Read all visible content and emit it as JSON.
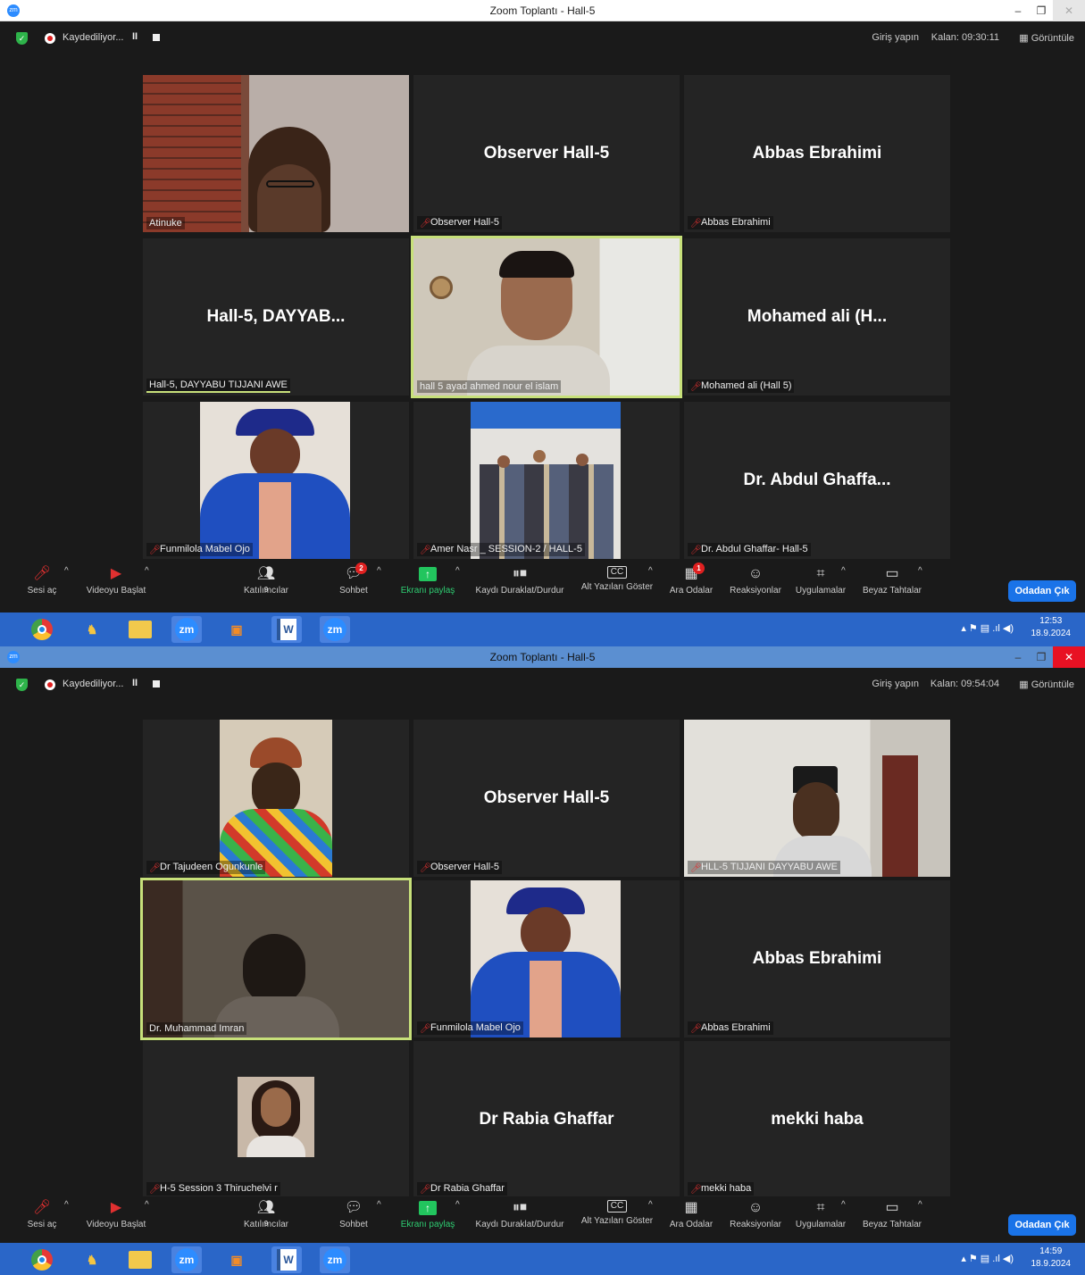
{
  "windows": [
    {
      "title": "Zoom Toplantı - Hall-5",
      "recording_text": "Kaydediliyor...",
      "signin": "Giriş yapın",
      "remaining": "Kalan: 09:30:11",
      "view": "Görüntüle",
      "tiles": [
        {
          "big": "",
          "label": "Atinuke",
          "muted": false,
          "photo": "person-glasses"
        },
        {
          "big": "Observer Hall-5",
          "label": "Observer Hall-5",
          "muted": true
        },
        {
          "big": "Abbas Ebrahimi",
          "label": "Abbas Ebrahimi",
          "muted": true
        },
        {
          "big": "Hall-5, DAYYAB...",
          "label": "Hall-5, DAYYABU TIJJANI AWE",
          "muted": false
        },
        {
          "big": "",
          "label": "hall 5  ayad ahmed nour el islam",
          "muted": false,
          "photo": "man-room"
        },
        {
          "big": "Mohamed ali (H...",
          "label": "Mohamed ali (Hall 5)",
          "muted": true
        },
        {
          "big": "",
          "label": "Funmilola Mabel Ojo",
          "muted": true,
          "photo": "graduation"
        },
        {
          "big": "",
          "label": "Amer Nasr _ SESSION-2 / HALL-5",
          "muted": true,
          "photo": "group"
        },
        {
          "big": "Dr. Abdul Ghaffa...",
          "label": "Dr. Abdul Ghaffar- Hall-5",
          "muted": true
        }
      ],
      "toolbar": {
        "unmute": "Sesi aç",
        "video": "Videoyu Başlat",
        "participants": "Katılımcılar",
        "participants_count": "9",
        "chat": "Sohbet",
        "chat_badge": "2",
        "share": "Ekranı paylaş",
        "record": "Kaydı Duraklat/Durdur",
        "captions": "Alt Yazıları Göster",
        "breakout": "Ara Odalar",
        "breakout_badge": "1",
        "reactions": "Reaksiyonlar",
        "apps": "Uygulamalar",
        "whiteboard": "Beyaz Tahtalar",
        "leave": "Odadan Çık"
      },
      "clock_time": "12:53",
      "clock_date": "18.9.2024"
    },
    {
      "title": "Zoom Toplantı - Hall-5",
      "recording_text": "Kaydediliyor...",
      "signin": "Giriş yapın",
      "remaining": "Kalan: 09:54:04",
      "view": "Görüntüle",
      "tiles": [
        {
          "big": "",
          "label": "Dr Tajudeen Ogunkunle",
          "muted": true,
          "photo": "man-cap"
        },
        {
          "big": "Observer Hall-5",
          "label": "Observer Hall-5",
          "muted": true
        },
        {
          "big": "",
          "label": "HLL-5 TIJJANI DAYYABU AWE",
          "muted": true,
          "photo": "man-white-room"
        },
        {
          "big": "",
          "label": "Dr. Muhammad Imran",
          "muted": false,
          "photo": "dark-cam"
        },
        {
          "big": "",
          "label": "Funmilola Mabel Ojo",
          "muted": true,
          "photo": "graduation"
        },
        {
          "big": "Abbas Ebrahimi",
          "label": "Abbas Ebrahimi",
          "muted": true
        },
        {
          "big": "",
          "label": "H-5 Session 3 Thiruchelvi r",
          "muted": true,
          "photo": "woman-portrait"
        },
        {
          "big": "Dr Rabia Ghaffar",
          "label": "Dr Rabia Ghaffar",
          "muted": true
        },
        {
          "big": "mekki haba",
          "label": "mekki haba",
          "muted": true
        }
      ],
      "toolbar": {
        "unmute": "Sesi aç",
        "video": "Videoyu Başlat",
        "participants": "Katılımcılar",
        "participants_count": "9",
        "chat": "Sohbet",
        "chat_badge": "",
        "share": "Ekranı paylaş",
        "record": "Kaydı Duraklat/Durdur",
        "captions": "Alt Yazıları Göster",
        "breakout": "Ara Odalar",
        "breakout_badge": "",
        "reactions": "Reaksiyonlar",
        "apps": "Uygulamalar",
        "whiteboard": "Beyaz Tahtalar",
        "leave": "Odadan Çık"
      },
      "clock_time": "14:59",
      "clock_date": "18.9.2024"
    }
  ],
  "colors": {
    "active_speaker_border": "#c7e07a",
    "leave_button": "#1a73e8",
    "taskbar": "#2a66c8",
    "share_green": "#22c55e"
  }
}
